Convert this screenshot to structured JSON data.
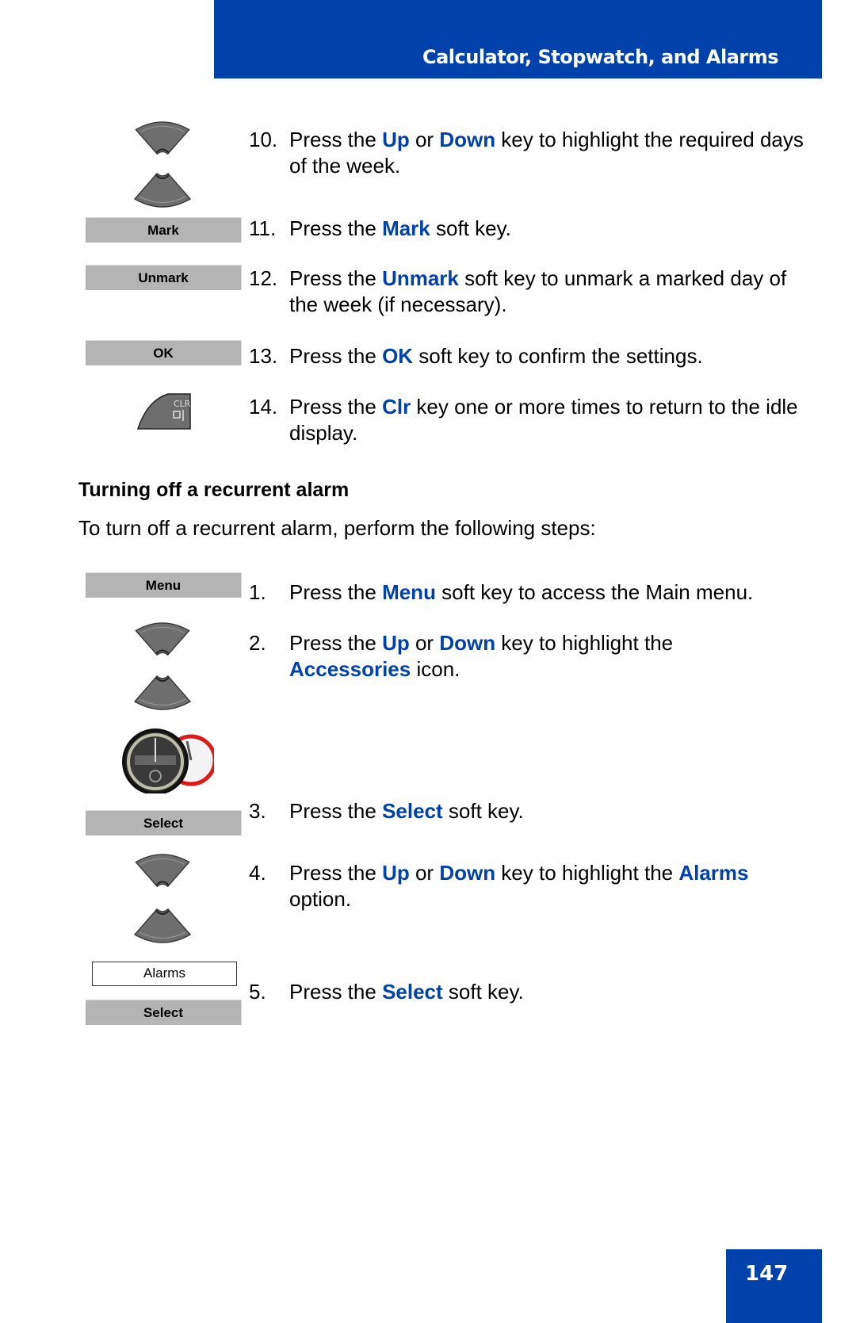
{
  "header": {
    "title": "Calculator, Stopwatch, and Alarms"
  },
  "colors": {
    "brand": "#0041ab",
    "softkey": "#b4b4b4"
  },
  "section1": {
    "steps": [
      {
        "num": "10.",
        "parts": [
          "Press the ",
          {
            "hl": "Up"
          },
          " or ",
          {
            "hl": "Down"
          },
          " key to highlight the required days of the week."
        ],
        "graphic": "nav-up-down-icon"
      },
      {
        "num": "11.",
        "parts": [
          "Press the ",
          {
            "hl": "Mark"
          },
          " soft key."
        ],
        "graphic": "softkey",
        "key": "Mark"
      },
      {
        "num": "12.",
        "parts": [
          "Press the ",
          {
            "hl": "Unmark"
          },
          " soft key to unmark a marked day of the week (if necessary)."
        ],
        "graphic": "softkey",
        "key": "Unmark"
      },
      {
        "num": "13.",
        "parts": [
          "Press the ",
          {
            "hl": "OK"
          },
          " soft key to confirm the settings."
        ],
        "graphic": "softkey",
        "key": "OK"
      },
      {
        "num": "14.",
        "parts": [
          "Press the ",
          {
            "hl": "Clr"
          },
          " key one or more times to return to the idle display."
        ],
        "graphic": "clr-key-icon",
        "key_label": "CLR"
      }
    ]
  },
  "section2": {
    "heading": "Turning off a recurrent alarm",
    "intro": "To turn off a recurrent alarm, perform the following steps:",
    "steps": [
      {
        "num": "1.",
        "parts": [
          "Press the ",
          {
            "hl": "Menu"
          },
          " soft key to access the Main menu."
        ],
        "graphic": "softkey",
        "key": "Menu"
      },
      {
        "num": "2.",
        "parts": [
          "Press the ",
          {
            "hl": "Up"
          },
          " or ",
          {
            "hl": "Down"
          },
          " key to highlight the ",
          {
            "hl": "Accessories"
          },
          " icon."
        ],
        "graphic": "nav-up-down-icon"
      },
      {
        "num": "3.",
        "parts": [
          "Press the ",
          {
            "hl": "Select"
          },
          " soft key."
        ],
        "graphic": "softkey",
        "key": "Select"
      },
      {
        "num": "4.",
        "parts": [
          "Press the ",
          {
            "hl": "Up"
          },
          " or ",
          {
            "hl": "Down"
          },
          " key to highlight the ",
          {
            "hl": "Alarms"
          },
          " option."
        ],
        "graphic": "nav-up-down-icon"
      },
      {
        "num": "5.",
        "parts": [
          "Press the ",
          {
            "hl": "Select"
          },
          " soft key."
        ],
        "graphic": "softkey",
        "key": "Select",
        "option_label": "Alarms"
      }
    ],
    "accessories_icon": "accessories-clock-icon"
  },
  "footer": {
    "page_number": "147"
  }
}
